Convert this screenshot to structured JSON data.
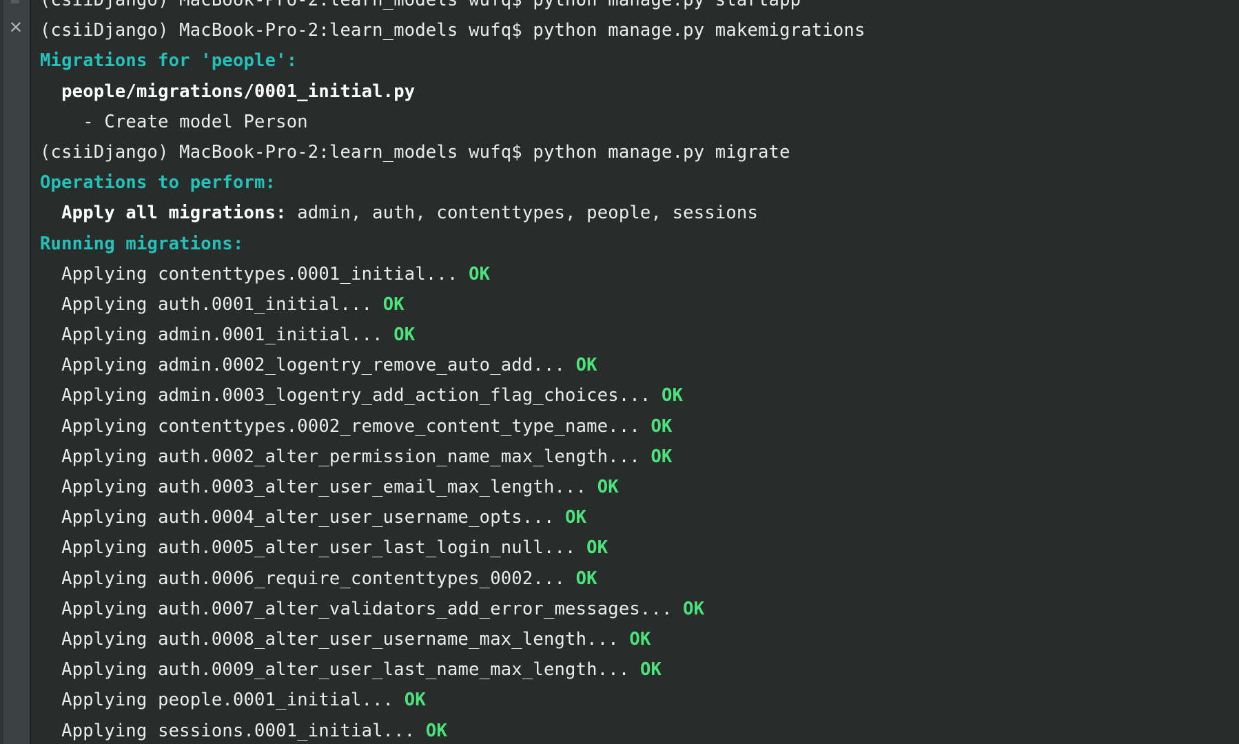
{
  "window": {
    "background_color": "#282c2a",
    "sidebar_color": "#3b4042",
    "accent_cyan": "#24c1bb",
    "accent_green": "#4ce37c",
    "text_color": "#eaedeb"
  },
  "sidebar": {
    "close_label": "×"
  },
  "terminal": {
    "lines": [
      {
        "id": "line-clipped-top",
        "clipped": true,
        "segments": [
          {
            "text": "(csiiDjango) MacBook-Pro-2:learn_models wufq$ python manage.py startapp",
            "style": "default"
          }
        ]
      },
      {
        "id": "line-prompt-makemigrations",
        "segments": [
          {
            "text": "(csiiDjango) MacBook-Pro-2:learn_models wufq$ python manage.py makemigrations",
            "style": "default"
          }
        ]
      },
      {
        "id": "line-migrations-for-people",
        "segments": [
          {
            "text": "Migrations for 'people':",
            "style": "cyan"
          }
        ]
      },
      {
        "id": "line-migration-file",
        "segments": [
          {
            "text": "  people/migrations/0001_initial.py",
            "style": "white-bold"
          }
        ]
      },
      {
        "id": "line-create-model-person",
        "segments": [
          {
            "text": "    - Create model Person",
            "style": "default"
          }
        ]
      },
      {
        "id": "line-prompt-migrate",
        "segments": [
          {
            "text": "(csiiDjango) MacBook-Pro-2:learn_models wufq$ python manage.py migrate",
            "style": "default"
          }
        ]
      },
      {
        "id": "line-operations-to-perform",
        "segments": [
          {
            "text": "Operations to perform:",
            "style": "cyan"
          }
        ]
      },
      {
        "id": "line-apply-all-migrations",
        "segments": [
          {
            "text": "  Apply all migrations:",
            "style": "white-bold"
          },
          {
            "text": " admin, auth, contenttypes, people, sessions",
            "style": "default"
          }
        ]
      },
      {
        "id": "line-running-migrations",
        "segments": [
          {
            "text": "Running migrations:",
            "style": "cyan"
          }
        ]
      },
      {
        "id": "line-apply-contenttypes-0001",
        "segments": [
          {
            "text": "  Applying contenttypes.0001_initial... ",
            "style": "default"
          },
          {
            "text": "OK",
            "style": "green"
          }
        ]
      },
      {
        "id": "line-apply-auth-0001",
        "segments": [
          {
            "text": "  Applying auth.0001_initial... ",
            "style": "default"
          },
          {
            "text": "OK",
            "style": "green"
          }
        ]
      },
      {
        "id": "line-apply-admin-0001",
        "segments": [
          {
            "text": "  Applying admin.0001_initial... ",
            "style": "default"
          },
          {
            "text": "OK",
            "style": "green"
          }
        ]
      },
      {
        "id": "line-apply-admin-0002",
        "segments": [
          {
            "text": "  Applying admin.0002_logentry_remove_auto_add... ",
            "style": "default"
          },
          {
            "text": "OK",
            "style": "green"
          }
        ]
      },
      {
        "id": "line-apply-admin-0003",
        "segments": [
          {
            "text": "  Applying admin.0003_logentry_add_action_flag_choices... ",
            "style": "default"
          },
          {
            "text": "OK",
            "style": "green"
          }
        ]
      },
      {
        "id": "line-apply-contenttypes-0002",
        "segments": [
          {
            "text": "  Applying contenttypes.0002_remove_content_type_name... ",
            "style": "default"
          },
          {
            "text": "OK",
            "style": "green"
          }
        ]
      },
      {
        "id": "line-apply-auth-0002",
        "segments": [
          {
            "text": "  Applying auth.0002_alter_permission_name_max_length... ",
            "style": "default"
          },
          {
            "text": "OK",
            "style": "green"
          }
        ]
      },
      {
        "id": "line-apply-auth-0003",
        "segments": [
          {
            "text": "  Applying auth.0003_alter_user_email_max_length... ",
            "style": "default"
          },
          {
            "text": "OK",
            "style": "green"
          }
        ]
      },
      {
        "id": "line-apply-auth-0004",
        "segments": [
          {
            "text": "  Applying auth.0004_alter_user_username_opts... ",
            "style": "default"
          },
          {
            "text": "OK",
            "style": "green"
          }
        ]
      },
      {
        "id": "line-apply-auth-0005",
        "segments": [
          {
            "text": "  Applying auth.0005_alter_user_last_login_null... ",
            "style": "default"
          },
          {
            "text": "OK",
            "style": "green"
          }
        ]
      },
      {
        "id": "line-apply-auth-0006",
        "segments": [
          {
            "text": "  Applying auth.0006_require_contenttypes_0002... ",
            "style": "default"
          },
          {
            "text": "OK",
            "style": "green"
          }
        ]
      },
      {
        "id": "line-apply-auth-0007",
        "segments": [
          {
            "text": "  Applying auth.0007_alter_validators_add_error_messages... ",
            "style": "default"
          },
          {
            "text": "OK",
            "style": "green"
          }
        ]
      },
      {
        "id": "line-apply-auth-0008",
        "segments": [
          {
            "text": "  Applying auth.0008_alter_user_username_max_length... ",
            "style": "default"
          },
          {
            "text": "OK",
            "style": "green"
          }
        ]
      },
      {
        "id": "line-apply-auth-0009",
        "segments": [
          {
            "text": "  Applying auth.0009_alter_user_last_name_max_length... ",
            "style": "default"
          },
          {
            "text": "OK",
            "style": "green"
          }
        ]
      },
      {
        "id": "line-apply-people-0001",
        "segments": [
          {
            "text": "  Applying people.0001_initial... ",
            "style": "default"
          },
          {
            "text": "OK",
            "style": "green"
          }
        ]
      },
      {
        "id": "line-apply-sessions-0001",
        "segments": [
          {
            "text": "  Applying sessions.0001_initial... ",
            "style": "default"
          },
          {
            "text": "OK",
            "style": "green"
          }
        ]
      }
    ]
  }
}
